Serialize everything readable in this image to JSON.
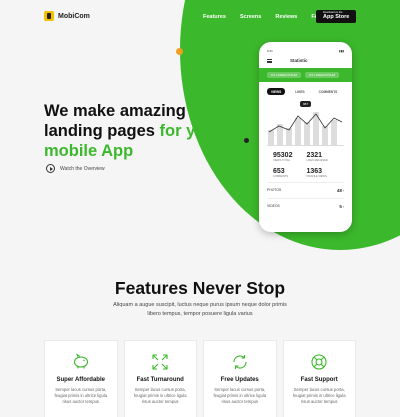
{
  "brand": {
    "name": "MobiCom"
  },
  "nav": {
    "items": [
      "Features",
      "Screens",
      "Reviews",
      "FAQs"
    ],
    "appstore_small": "Download on the",
    "appstore_big": "App Store"
  },
  "hero": {
    "title_part1": "We make amazing landing pages ",
    "title_green1": "for",
    "title_part2": " ",
    "title_green2": "your mobile App",
    "watch_label": "Watch the Overview"
  },
  "phone": {
    "time": "9:41",
    "title": "Statistic",
    "band_pills": [
      "9.5 LOREM IPSUM",
      "9.5 LOREM IPSUM"
    ],
    "tabs": [
      "VIEWS",
      "LIKES",
      "COMMENTS"
    ],
    "chart_bubble": "987",
    "stats": [
      {
        "num": "95302",
        "label": "VIEWS TOTAL"
      },
      {
        "num": "2321",
        "label": "LIKES RECIEVED"
      },
      {
        "num": "653",
        "label": "COMMENTS"
      },
      {
        "num": "1363",
        "label": "PROFILE VIEWS"
      }
    ],
    "rows": [
      {
        "label": "PHOTOS",
        "value": "48"
      },
      {
        "label": "VIDEOS",
        "value": "5"
      }
    ]
  },
  "features": {
    "title": "Features Never Stop",
    "subtitle": "Aliquam a augue suscipit, luctus neque purus ipsum neque dolor primis libero tempus, tempor posuere ligula varius",
    "cards": [
      {
        "name": "Super Affordable",
        "icon": "piggy-bank-icon",
        "desc": "Semper lacus cursus porta, feugiat primis in ultrice ligula risus auctor tempus"
      },
      {
        "name": "Fast Turnaround",
        "icon": "expand-arrows-icon",
        "desc": "Semper lacus cursus porta, feugiat primis in ultrice ligula risus auctor tempus"
      },
      {
        "name": "Free Updates",
        "icon": "refresh-icon",
        "desc": "Semper lacus cursus porta, feugiat primis in ultrice ligula risus auctor tempus"
      },
      {
        "name": "Fast Support",
        "icon": "lifebuoy-icon",
        "desc": "Semper lacus cursus porta, feugiat primis in ultrice ligula risus auctor tempus"
      }
    ]
  },
  "colors": {
    "accent": "#3cb82c",
    "dark": "#111111"
  }
}
